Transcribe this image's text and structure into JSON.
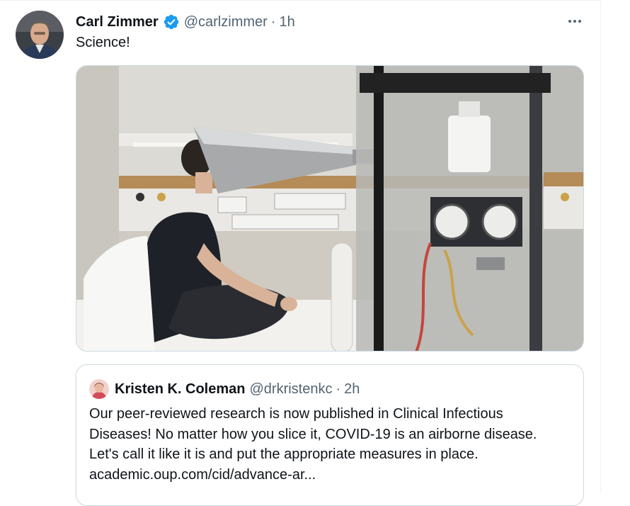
{
  "tweet": {
    "author_name": "Carl Zimmer",
    "handle": "@carlzimmer",
    "separator": "·",
    "time": "1h",
    "text": "Science!",
    "verified": true,
    "verified_color": "#1d9bf0"
  },
  "quote": {
    "author_name": "Kristen K. Coleman",
    "handle": "@drkristenkc",
    "separator": "·",
    "time": "2h",
    "lines": [
      "Our peer-reviewed research is now published in Clinical Infectious",
      "Diseases! No matter how you slice it, COVID-19 is an airborne disease.",
      "Let's call it like it is and put the appropriate measures in place.",
      "academic.oup.com/cid/advance-ar..."
    ]
  },
  "icons": {
    "more": "more-options-icon",
    "verified": "verified-badge-icon"
  },
  "colors": {
    "text": "#0f1419",
    "secondary": "#536471",
    "border": "#cfd9de"
  }
}
